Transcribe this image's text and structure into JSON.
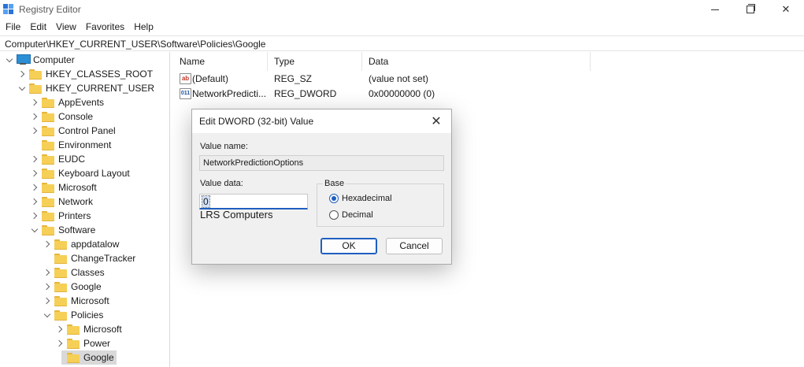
{
  "window": {
    "title": "Registry Editor",
    "close_glyph": "✕"
  },
  "menu": [
    "File",
    "Edit",
    "View",
    "Favorites",
    "Help"
  ],
  "address": "Computer\\HKEY_CURRENT_USER\\Software\\Policies\\Google",
  "tree": {
    "root": "Computer",
    "items": [
      {
        "label": "HKEY_CLASSES_ROOT"
      },
      {
        "label": "HKEY_CURRENT_USER"
      },
      {
        "label": "AppEvents"
      },
      {
        "label": "Console"
      },
      {
        "label": "Control Panel"
      },
      {
        "label": "Environment"
      },
      {
        "label": "EUDC"
      },
      {
        "label": "Keyboard Layout"
      },
      {
        "label": "Microsoft"
      },
      {
        "label": "Network"
      },
      {
        "label": "Printers"
      },
      {
        "label": "Software"
      },
      {
        "label": "appdatalow"
      },
      {
        "label": "ChangeTracker"
      },
      {
        "label": "Classes"
      },
      {
        "label": "Google"
      },
      {
        "label": "Microsoft"
      },
      {
        "label": "Policies"
      },
      {
        "label": "Microsoft"
      },
      {
        "label": "Power"
      },
      {
        "label": "Google"
      }
    ]
  },
  "list": {
    "headers": {
      "name": "Name",
      "type": "Type",
      "data": "Data"
    },
    "rows": [
      {
        "icon": "ab",
        "name": "(Default)",
        "type": "REG_SZ",
        "data": "(value not set)"
      },
      {
        "icon": "011",
        "name": "NetworkPredicti...",
        "type": "REG_DWORD",
        "data": "0x00000000 (0)"
      }
    ]
  },
  "dialog": {
    "title": "Edit DWORD (32-bit) Value",
    "close_glyph": "✕",
    "value_name_label": "Value name:",
    "value_name": "NetworkPredictionOptions",
    "value_data_label": "Value data:",
    "value_data": "0",
    "sub_text": "LRS Computers",
    "base_label": "Base",
    "base_options": [
      {
        "label": "Hexadecimal",
        "selected": true
      },
      {
        "label": "Decimal",
        "selected": false
      }
    ],
    "ok_label": "OK",
    "cancel_label": "Cancel"
  },
  "colors": {
    "accent": "#1f5fbf",
    "folder": "#f6cf57",
    "selected_row": "#d9d9d9"
  }
}
